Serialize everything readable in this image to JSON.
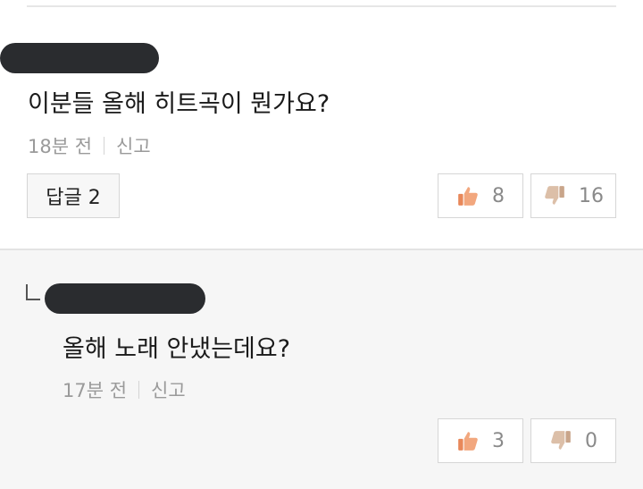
{
  "colors": {
    "like_icon": "#e8885a",
    "dislike_icon": "#c9a58a",
    "redaction": "#2a2c2f",
    "reply_background": "#f6f6f6"
  },
  "comments": [
    {
      "text": "이분들 올해 히트곡이 뭔가요?",
      "time": "18분 전",
      "report_label": "신고",
      "reply_button_label": "답글 2",
      "likes": "8",
      "dislikes": "16"
    }
  ],
  "replies": [
    {
      "text": "올해 노래 안냈는데요?",
      "time": "17분 전",
      "report_label": "신고",
      "likes": "3",
      "dislikes": "0"
    }
  ],
  "icons": {
    "like": "thumbs-up-icon",
    "dislike": "thumbs-down-icon",
    "reply_indicator": "reply-arrow-icon"
  }
}
